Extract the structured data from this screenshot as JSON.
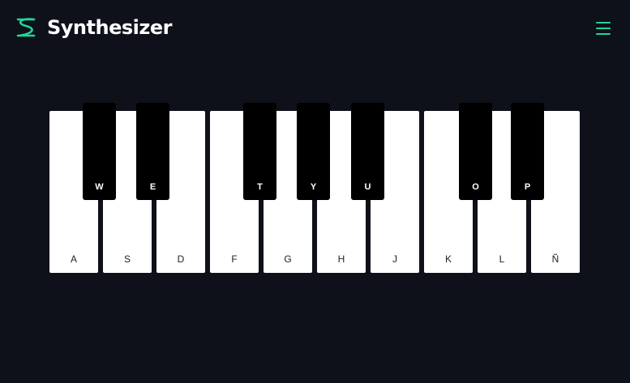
{
  "header": {
    "title": "Synthesizer",
    "logo_icon": "synth-wave-logo-icon",
    "menu_icon": "hamburger-menu-icon",
    "accent_color": "#22d39a"
  },
  "keyboard": {
    "white_keys": [
      "A",
      "S",
      "D",
      "F",
      "G",
      "H",
      "J",
      "K",
      "L",
      "Ñ"
    ],
    "black_keys": [
      "W",
      "E",
      "T",
      "Y",
      "U",
      "O",
      "P"
    ]
  },
  "colors": {
    "background": "#0e111a",
    "white_key": "#ffffff",
    "black_key": "#000000"
  }
}
